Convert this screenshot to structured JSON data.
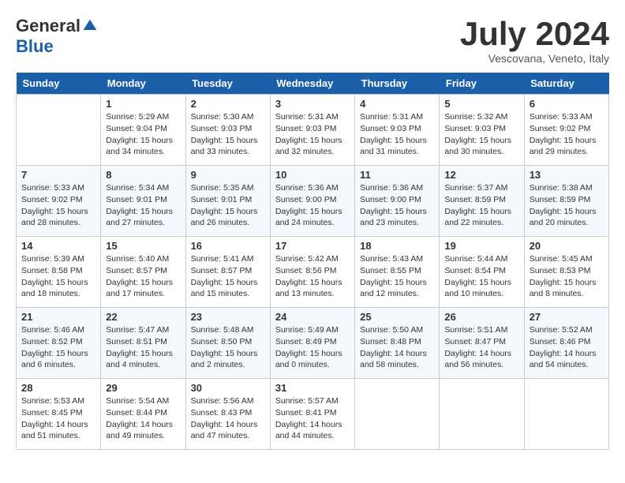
{
  "header": {
    "logo_general": "General",
    "logo_blue": "Blue",
    "month_title": "July 2024",
    "subtitle": "Vescovana, Veneto, Italy"
  },
  "days_of_week": [
    "Sunday",
    "Monday",
    "Tuesday",
    "Wednesday",
    "Thursday",
    "Friday",
    "Saturday"
  ],
  "weeks": [
    [
      {
        "day": "",
        "info": ""
      },
      {
        "day": "1",
        "info": "Sunrise: 5:29 AM\nSunset: 9:04 PM\nDaylight: 15 hours\nand 34 minutes."
      },
      {
        "day": "2",
        "info": "Sunrise: 5:30 AM\nSunset: 9:03 PM\nDaylight: 15 hours\nand 33 minutes."
      },
      {
        "day": "3",
        "info": "Sunrise: 5:31 AM\nSunset: 9:03 PM\nDaylight: 15 hours\nand 32 minutes."
      },
      {
        "day": "4",
        "info": "Sunrise: 5:31 AM\nSunset: 9:03 PM\nDaylight: 15 hours\nand 31 minutes."
      },
      {
        "day": "5",
        "info": "Sunrise: 5:32 AM\nSunset: 9:03 PM\nDaylight: 15 hours\nand 30 minutes."
      },
      {
        "day": "6",
        "info": "Sunrise: 5:33 AM\nSunset: 9:02 PM\nDaylight: 15 hours\nand 29 minutes."
      }
    ],
    [
      {
        "day": "7",
        "info": "Sunrise: 5:33 AM\nSunset: 9:02 PM\nDaylight: 15 hours\nand 28 minutes."
      },
      {
        "day": "8",
        "info": "Sunrise: 5:34 AM\nSunset: 9:01 PM\nDaylight: 15 hours\nand 27 minutes."
      },
      {
        "day": "9",
        "info": "Sunrise: 5:35 AM\nSunset: 9:01 PM\nDaylight: 15 hours\nand 26 minutes."
      },
      {
        "day": "10",
        "info": "Sunrise: 5:36 AM\nSunset: 9:00 PM\nDaylight: 15 hours\nand 24 minutes."
      },
      {
        "day": "11",
        "info": "Sunrise: 5:36 AM\nSunset: 9:00 PM\nDaylight: 15 hours\nand 23 minutes."
      },
      {
        "day": "12",
        "info": "Sunrise: 5:37 AM\nSunset: 8:59 PM\nDaylight: 15 hours\nand 22 minutes."
      },
      {
        "day": "13",
        "info": "Sunrise: 5:38 AM\nSunset: 8:59 PM\nDaylight: 15 hours\nand 20 minutes."
      }
    ],
    [
      {
        "day": "14",
        "info": "Sunrise: 5:39 AM\nSunset: 8:58 PM\nDaylight: 15 hours\nand 18 minutes."
      },
      {
        "day": "15",
        "info": "Sunrise: 5:40 AM\nSunset: 8:57 PM\nDaylight: 15 hours\nand 17 minutes."
      },
      {
        "day": "16",
        "info": "Sunrise: 5:41 AM\nSunset: 8:57 PM\nDaylight: 15 hours\nand 15 minutes."
      },
      {
        "day": "17",
        "info": "Sunrise: 5:42 AM\nSunset: 8:56 PM\nDaylight: 15 hours\nand 13 minutes."
      },
      {
        "day": "18",
        "info": "Sunrise: 5:43 AM\nSunset: 8:55 PM\nDaylight: 15 hours\nand 12 minutes."
      },
      {
        "day": "19",
        "info": "Sunrise: 5:44 AM\nSunset: 8:54 PM\nDaylight: 15 hours\nand 10 minutes."
      },
      {
        "day": "20",
        "info": "Sunrise: 5:45 AM\nSunset: 8:53 PM\nDaylight: 15 hours\nand 8 minutes."
      }
    ],
    [
      {
        "day": "21",
        "info": "Sunrise: 5:46 AM\nSunset: 8:52 PM\nDaylight: 15 hours\nand 6 minutes."
      },
      {
        "day": "22",
        "info": "Sunrise: 5:47 AM\nSunset: 8:51 PM\nDaylight: 15 hours\nand 4 minutes."
      },
      {
        "day": "23",
        "info": "Sunrise: 5:48 AM\nSunset: 8:50 PM\nDaylight: 15 hours\nand 2 minutes."
      },
      {
        "day": "24",
        "info": "Sunrise: 5:49 AM\nSunset: 8:49 PM\nDaylight: 15 hours\nand 0 minutes."
      },
      {
        "day": "25",
        "info": "Sunrise: 5:50 AM\nSunset: 8:48 PM\nDaylight: 14 hours\nand 58 minutes."
      },
      {
        "day": "26",
        "info": "Sunrise: 5:51 AM\nSunset: 8:47 PM\nDaylight: 14 hours\nand 56 minutes."
      },
      {
        "day": "27",
        "info": "Sunrise: 5:52 AM\nSunset: 8:46 PM\nDaylight: 14 hours\nand 54 minutes."
      }
    ],
    [
      {
        "day": "28",
        "info": "Sunrise: 5:53 AM\nSunset: 8:45 PM\nDaylight: 14 hours\nand 51 minutes."
      },
      {
        "day": "29",
        "info": "Sunrise: 5:54 AM\nSunset: 8:44 PM\nDaylight: 14 hours\nand 49 minutes."
      },
      {
        "day": "30",
        "info": "Sunrise: 5:56 AM\nSunset: 8:43 PM\nDaylight: 14 hours\nand 47 minutes."
      },
      {
        "day": "31",
        "info": "Sunrise: 5:57 AM\nSunset: 8:41 PM\nDaylight: 14 hours\nand 44 minutes."
      },
      {
        "day": "",
        "info": ""
      },
      {
        "day": "",
        "info": ""
      },
      {
        "day": "",
        "info": ""
      }
    ]
  ]
}
